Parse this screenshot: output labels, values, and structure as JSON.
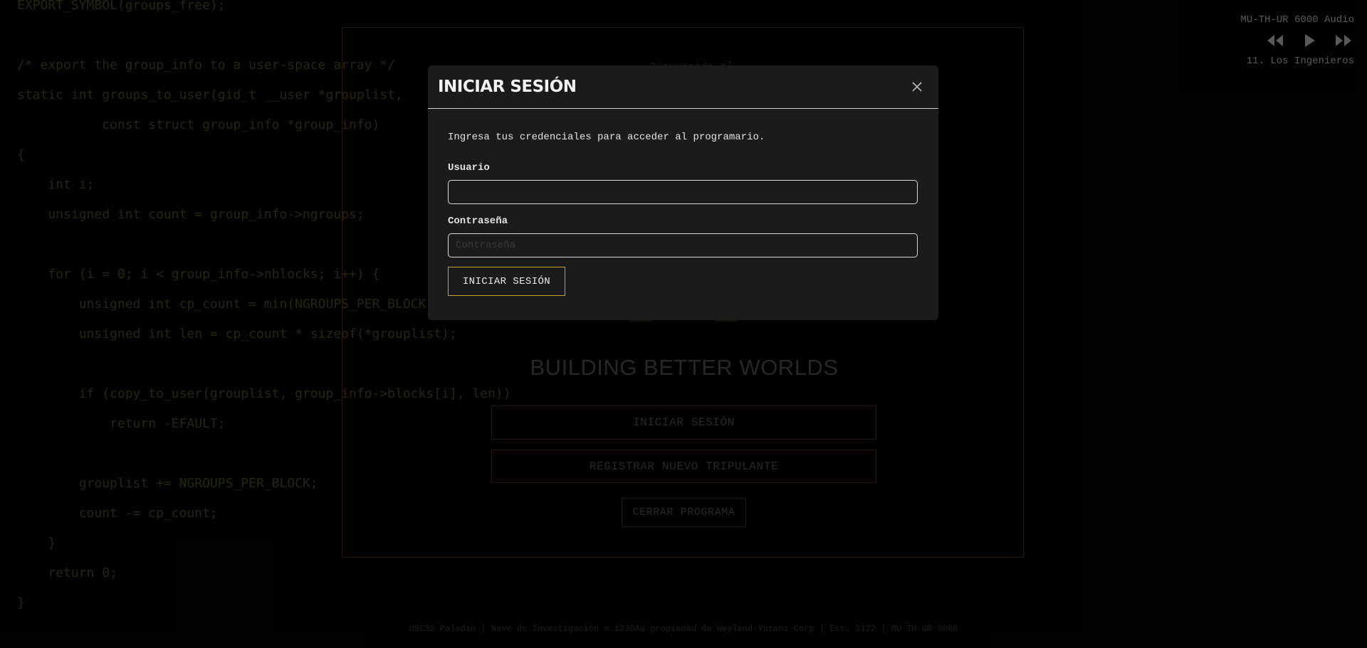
{
  "background_code": {
    "lines": [
      "EXPORT_SYMBOL(groups_free);",
      "",
      "/* export the group_info to a user-space array */",
      "static int groups_to_user(gid_t __user *grouplist,",
      "           const struct group_info *group_info)",
      "{",
      "    int i;",
      "    unsigned int count = group_info->ngroups;",
      "",
      "    for (i = 0; i < group_info->nblocks; i++) {",
      "        unsigned int cp_count = min(NGROUPS_PER_BLOCK, count);",
      "        unsigned int len = cp_count * sizeof(*grouplist);",
      "",
      "        if (copy_to_user(grouplist, group_info->blocks[i], len))",
      "            return -EFAULT;",
      "",
      "        grouplist += NGROUPS_PER_BLOCK;",
      "        count -= cp_count;",
      "    }",
      "    return 0;",
      "}"
    ]
  },
  "audio_player": {
    "title": "MU-TH-UR 6000 Audio",
    "track": "11. Los Ingenieros",
    "controls": [
      "rewind-icon",
      "play-icon",
      "fast-forward-icon"
    ]
  },
  "terminal": {
    "partial_text": "Bienvenido al",
    "tagline": "BUILDING BETTER WORLDS",
    "buttons": {
      "login": "INICIAR SESIÓN",
      "register": "REGISTRAR NUEVO TRIPULANTE",
      "close": "CERRAR PROGRAMA"
    }
  },
  "footer": {
    "text": "USCSS Paladio | Nave de Investigación n.123DAW propiedad de Weyland-Yutani Corp | Est. 2122 | MU-TH-UR 6000"
  },
  "modal": {
    "title": "INICIAR SESIÓN",
    "close_icon": "close-icon",
    "description": "Ingresa tus credenciales para acceder al programario.",
    "username": {
      "label": "Usuario",
      "value": "",
      "placeholder": ""
    },
    "password": {
      "label": "Contraseña",
      "value": "",
      "placeholder": "Contraseña"
    },
    "submit_label": "INICIAR SESIÓN"
  },
  "colors": {
    "accent_gold": "#c9a227",
    "frame_border": "#3b2410",
    "modal_bg": "#1b1b1b",
    "code_text": "#3d3a1a"
  }
}
